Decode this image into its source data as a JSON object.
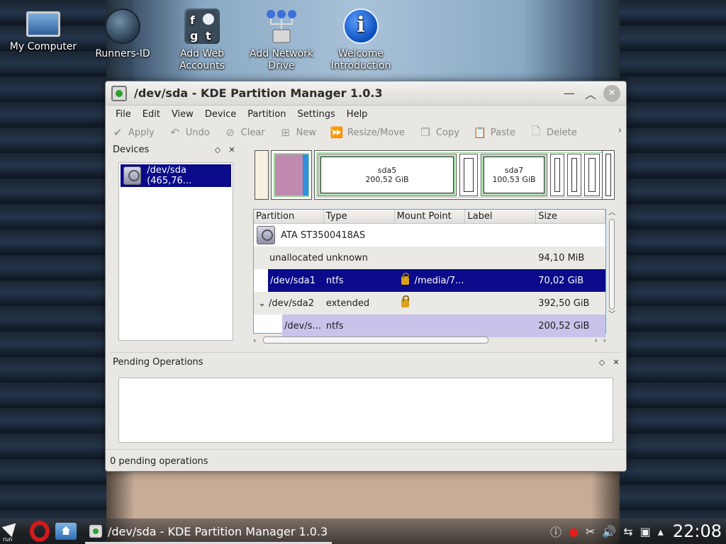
{
  "desktop": {
    "icons": [
      {
        "label": "My Computer"
      },
      {
        "label": "Runners-ID"
      },
      {
        "label": "Add Web Accounts"
      },
      {
        "label": "Add Network Drive"
      },
      {
        "label": "Welcome Introduction"
      }
    ]
  },
  "window": {
    "title": "/dev/sda - KDE Partition Manager 1.0.3",
    "menu": [
      "File",
      "Edit",
      "View",
      "Device",
      "Partition",
      "Settings",
      "Help"
    ],
    "toolbar": {
      "apply": "Apply",
      "undo": "Undo",
      "clear": "Clear",
      "new": "New",
      "resize": "Resize/Move",
      "copy": "Copy",
      "paste": "Paste",
      "delete": "Delete",
      "more": "›"
    },
    "devices": {
      "heading": "Devices",
      "items": [
        {
          "label": "/dev/sda (465,76..."
        }
      ]
    },
    "graph": {
      "sda5": {
        "name": "sda5",
        "size": "200,52 GiB"
      },
      "sda7": {
        "name": "sda7",
        "size": "100,53 GiB"
      }
    },
    "table": {
      "columns": [
        "Partition",
        "Type",
        "Mount Point",
        "Label",
        "Size"
      ],
      "disk": "ATA ST3500418AS",
      "rows": [
        {
          "partition": "unallocated",
          "type": "unknown",
          "mount": "",
          "label": "",
          "size": "94,10 MiB"
        },
        {
          "partition": "/dev/sda1",
          "type": "ntfs",
          "mount": "/media/7...",
          "label": "",
          "size": "70,02 GiB"
        },
        {
          "partition": "/dev/sda2",
          "type": "extended",
          "mount": "",
          "label": "",
          "size": "392,50 GiB"
        },
        {
          "partition": "/dev/s...",
          "type": "ntfs",
          "mount": "",
          "label": "",
          "size": "200,52 GiB"
        }
      ],
      "expander": "⌄"
    },
    "pending": {
      "heading": "Pending Operations",
      "status": "0 pending operations"
    }
  },
  "taskbar": {
    "run_label": "run",
    "task_title": "/dev/sda - KDE Partition Manager 1.0.3",
    "clock": "22:08"
  }
}
